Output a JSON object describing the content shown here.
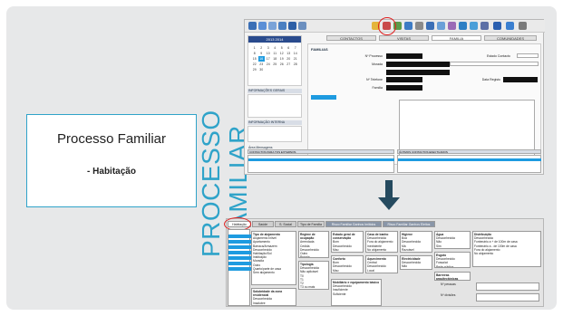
{
  "slide": {
    "title": "Processo Familiar",
    "subtitle": "-   Habitação",
    "vertical_lines": [
      "PROCESSO",
      "FAMILIAR"
    ],
    "accent_color": "#2fa3c9"
  },
  "app_top": {
    "tabs": [
      "CONTACTOS",
      "VISITAS",
      "FAMILIA",
      "COMUNIDADES"
    ],
    "section": "FAMILIAS",
    "labels": {
      "processo": "Nº Processo",
      "morada": "Morada",
      "telefone": "Nº Telefone",
      "familia": "Família",
      "estado": "Estado Contacto",
      "data": "Data Registo"
    },
    "calendar": {
      "header": "2013 2014",
      "days": [
        "1",
        "2",
        "3",
        "4",
        "5",
        "6",
        "7",
        "8",
        "9",
        "10",
        "11",
        "12",
        "13",
        "14",
        "15",
        "16",
        "17",
        "18",
        "19",
        "20",
        "21",
        "22",
        "23",
        "24",
        "25",
        "26",
        "27",
        "28",
        "29",
        "30"
      ]
    },
    "left_headers": [
      "INFORMAÇÕES GERAIS",
      "INFORMAÇÃO INTERNA",
      "Área Mensagens"
    ],
    "lower_headers": [
      "CONTACTOS PARA TOS EXTERNOS",
      "ÚLTIMOS CONTACTOS EFECTUADOS"
    ]
  },
  "app_bottom": {
    "tabs": [
      "Habitação",
      "Saúde",
      "S. Social",
      "Tipo de Família",
      "Risco Familiar Ganhos Imitidos",
      "Risco Familiar Ganhos Eleitos"
    ],
    "groups": [
      {
        "title": "Tipo de alojamento",
        "items": [
          "Alojamento Inlivel",
          "Apartamento",
          "Barraca/Armazém",
          "Desconhecido",
          "Habitação/Sol",
          "Institulção",
          "Moradia",
          "Outro",
          "Quarto/parte de casa",
          "Sem alojamento"
        ]
      },
      {
        "title": "Regime de ocupação",
        "items": [
          "Arrendada",
          "Cedida",
          "Desconhecido",
          "Outro",
          "Própria"
        ]
      },
      {
        "title": "Estado geral de conservação",
        "items": [
          "Bom",
          "Desconhecido",
          "Mau",
          "Razoável"
        ]
      },
      {
        "title": "Casa de banho",
        "items": [
          "Desconhecida",
          "Fora do alojamento",
          "Inexistente",
          "No alojamento"
        ]
      },
      {
        "title": "Higiene",
        "items": [
          "Boa",
          "Desconhecida",
          "Má",
          "Razoável"
        ]
      },
      {
        "title": "Água",
        "items": [
          "Desconhecida",
          "Não",
          "Sim"
        ]
      },
      {
        "title": "Distribuição",
        "items": [
          "Desconhecida",
          "Fontenário a + de 100m de casa",
          "Fontenário a - de 100m de casa",
          "Fora do alojamento",
          "No alojamento"
        ]
      },
      {
        "title": "Tipologia",
        "items": [
          "Desconhecida",
          "Não aplicável",
          "T0",
          "T1",
          "T2",
          "T3 ou mais"
        ]
      },
      {
        "title": "Conforto",
        "items": [
          "Bom",
          "Desconhecido",
          "Mau",
          "Razoável"
        ]
      },
      {
        "title": "Aquecimento",
        "items": [
          "Central",
          "Desconhecido",
          "Local",
          "Nenhum"
        ]
      },
      {
        "title": "Electricidade",
        "items": [
          "Desconhecida",
          "Não",
          "Sim"
        ]
      },
      {
        "title": "Esgoto",
        "items": [
          "Desconhecido",
          "Fossa/at",
          "Rede pública"
        ]
      },
      {
        "title": "Salubridade da zona residencial",
        "items": [
          "Desconhecida",
          "Insalubre",
          "Salubre"
        ]
      },
      {
        "title": "Mobiliário e equipamento básico",
        "items": [
          "Desconhecido",
          "Insuficiente",
          "Suficiente"
        ]
      },
      {
        "title": "Barreiras arquitectónicas",
        "items": [
          "Desconhecidas",
          "Não",
          "Sim"
        ]
      }
    ],
    "observations": [
      "Nº pessoas",
      "Nº divisões"
    ]
  },
  "colors": {
    "slide_bg": "#e7e8e9",
    "arrow": "#254a5f",
    "highlight_circle": "#e02020",
    "panel_dark": "#111111",
    "selection_blue": "#1e9be0"
  }
}
